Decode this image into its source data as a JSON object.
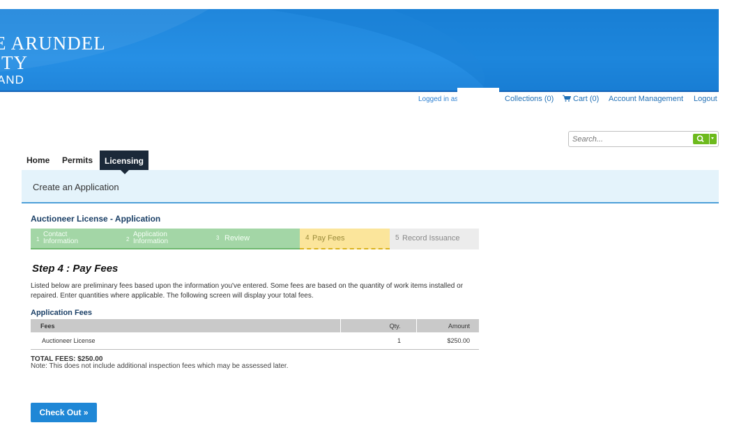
{
  "brand": {
    "line1": "E ARUNDEL",
    "line2": "ITY",
    "line3": "AND"
  },
  "utility": {
    "logged_in": "Logged in as",
    "collections": "Collections (0)",
    "cart": "Cart (0)",
    "account": "Account Management",
    "logout": "Logout"
  },
  "search": {
    "placeholder": "Search..."
  },
  "nav": {
    "items": [
      {
        "label": "Home",
        "active": false
      },
      {
        "label": "Permits",
        "active": false
      },
      {
        "label": "Licensing",
        "active": true
      }
    ]
  },
  "page": {
    "header": "Create an Application",
    "app_title": "Auctioneer License - Application"
  },
  "steps": [
    {
      "num": "1",
      "label_l1": "Contact",
      "label_l2": "Information",
      "state": "done"
    },
    {
      "num": "2",
      "label_l1": "Application",
      "label_l2": "Information",
      "state": "done"
    },
    {
      "num": "3",
      "label": "Review",
      "state": "done"
    },
    {
      "num": "4",
      "label": "Pay Fees",
      "state": "current"
    },
    {
      "num": "5",
      "label": "Record Issuance",
      "state": "todo"
    }
  ],
  "step_heading": "Step 4 : Pay Fees",
  "description": "Listed below are preliminary fees based upon the information you've entered. Some fees are based on the quantity of work items installed or repaired. Enter quantities where applicable. The following screen will display your total fees.",
  "fees": {
    "section_title": "Application Fees",
    "columns": {
      "fees": "Fees",
      "qty": "Qty.",
      "amount": "Amount"
    },
    "rows": [
      {
        "fee": "Auctioneer License",
        "qty": "1",
        "amount": "$250.00"
      }
    ],
    "total": "TOTAL FEES: $250.00",
    "note": "Note: This does not include additional inspection fees which may be assessed later."
  },
  "checkout_label": "Check Out »",
  "colors": {
    "banner": "#1b82d8",
    "nav_active": "#1b2939",
    "step_done": "#a3d6a6",
    "step_current": "#fbe59b",
    "button": "#1f87d6"
  }
}
